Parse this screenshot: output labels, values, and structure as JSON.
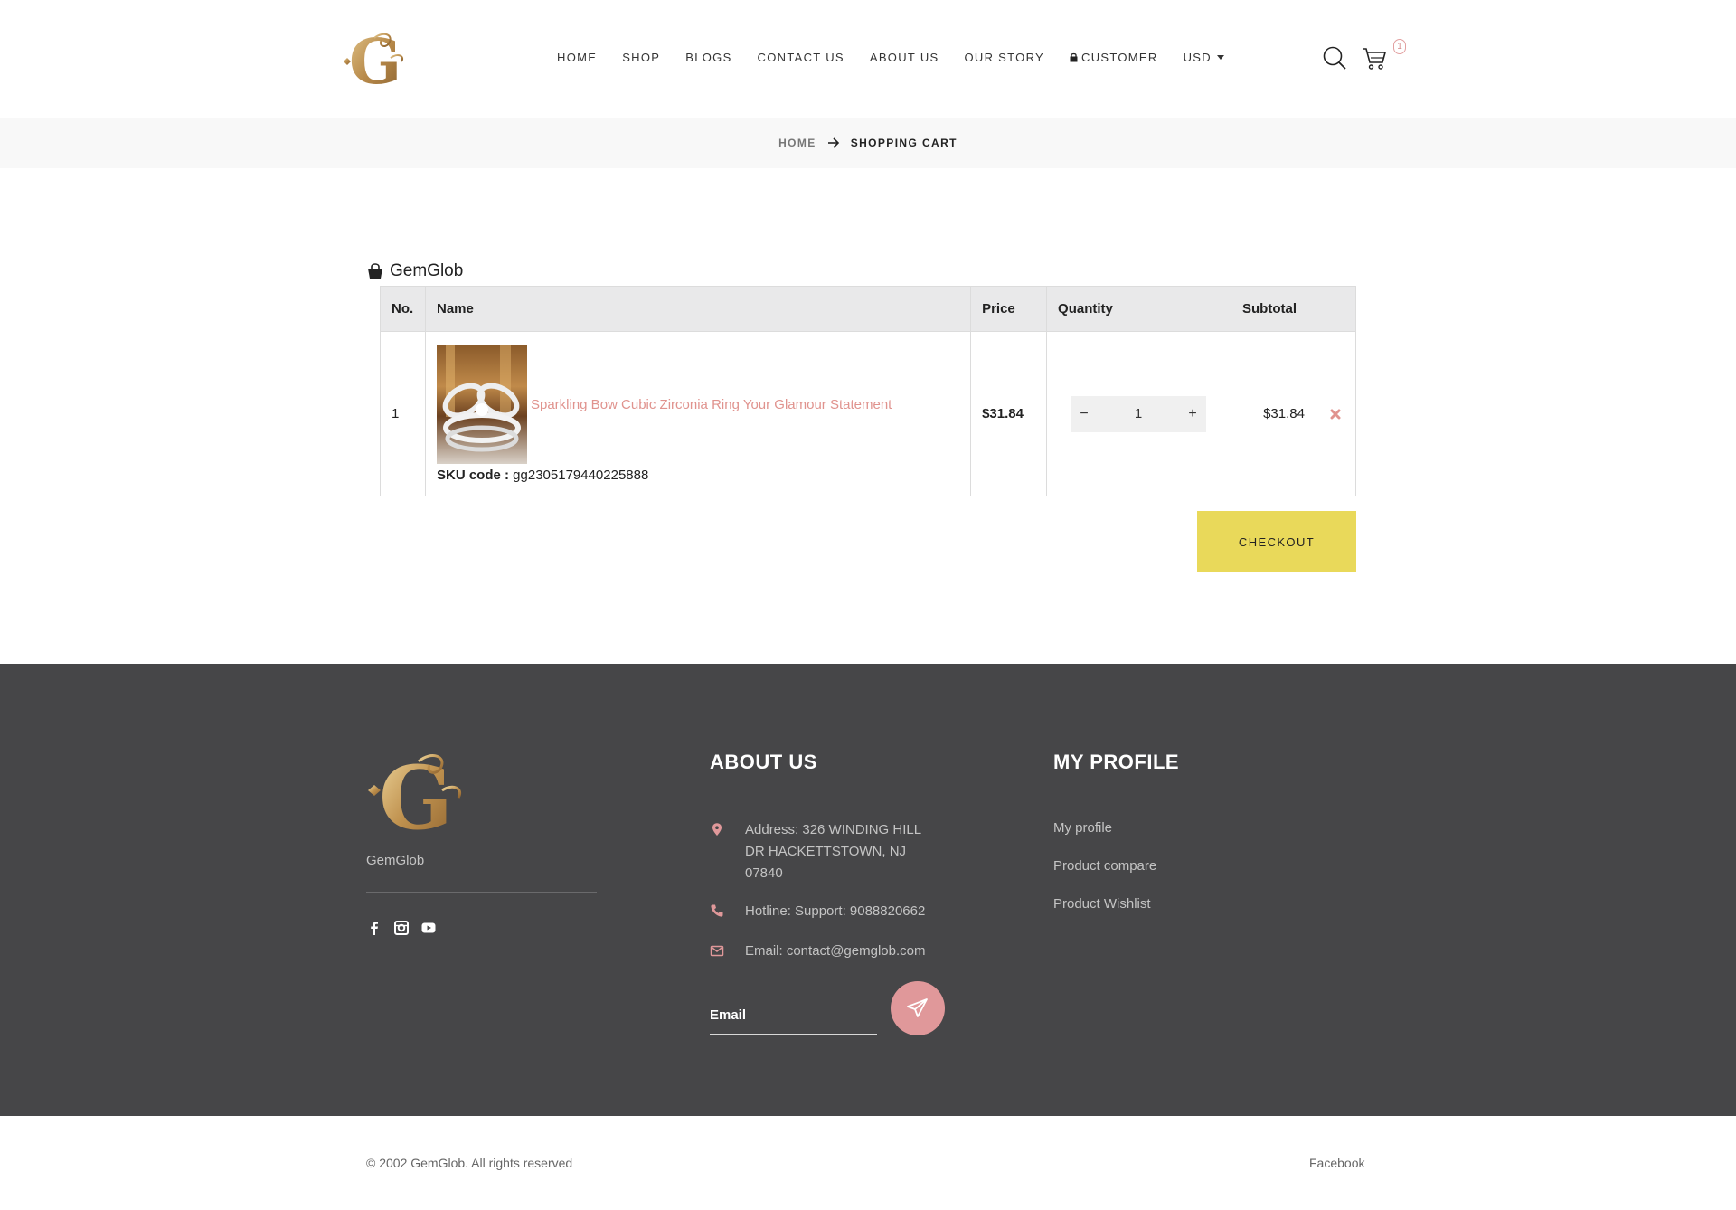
{
  "brand": {
    "name": "GemGlob",
    "accent": "#e0938e",
    "logo_color": "#b88a4a"
  },
  "header": {
    "nav": [
      {
        "label": "HOME"
      },
      {
        "label": "SHOP"
      },
      {
        "label": "BLOGS"
      },
      {
        "label": "CONTACT US"
      },
      {
        "label": "ABOUT US"
      },
      {
        "label": "OUR STORY"
      },
      {
        "label": "CUSTOMER",
        "icon": "lock-icon"
      },
      {
        "label": "USD",
        "icon": "caret-down-icon"
      }
    ],
    "cart_count": "1"
  },
  "breadcrumb": {
    "home": "HOME",
    "current": "SHOPPING CART"
  },
  "cart": {
    "shop_name": "GemGlob",
    "columns": [
      "No.",
      "Name",
      "Price",
      "Quantity",
      "Subtotal",
      ""
    ],
    "items": [
      {
        "no": "1",
        "name": "Sparkling Bow Cubic Zirconia Ring Your Glamour Statement",
        "sku_label": "SKU code :",
        "sku": "gg2305179440225888",
        "price": "$31.84",
        "quantity": "1",
        "subtotal": "$31.84"
      }
    ],
    "checkout_label": "CHECKOUT",
    "checkout_color": "#e9d95a"
  },
  "footer": {
    "brand_label": "GemGlob",
    "social": [
      "facebook-icon",
      "instagram-icon",
      "youtube-icon"
    ],
    "about": {
      "heading": "ABOUT US",
      "address": "Address: 326 WINDING HILL DR HACKETTSTOWN, NJ 07840",
      "hotline": "Hotline: Support: 9088820662",
      "email": "Email: contact@gemglob.com",
      "email_placeholder": "Email"
    },
    "profile": {
      "heading": "MY PROFILE",
      "links": [
        "My profile",
        "Product compare",
        "Product Wishlist"
      ]
    },
    "background": "#464648"
  },
  "bottom": {
    "copyright": "© 2002 GemGlob.  All rights reserved",
    "facebook": "Facebook"
  }
}
